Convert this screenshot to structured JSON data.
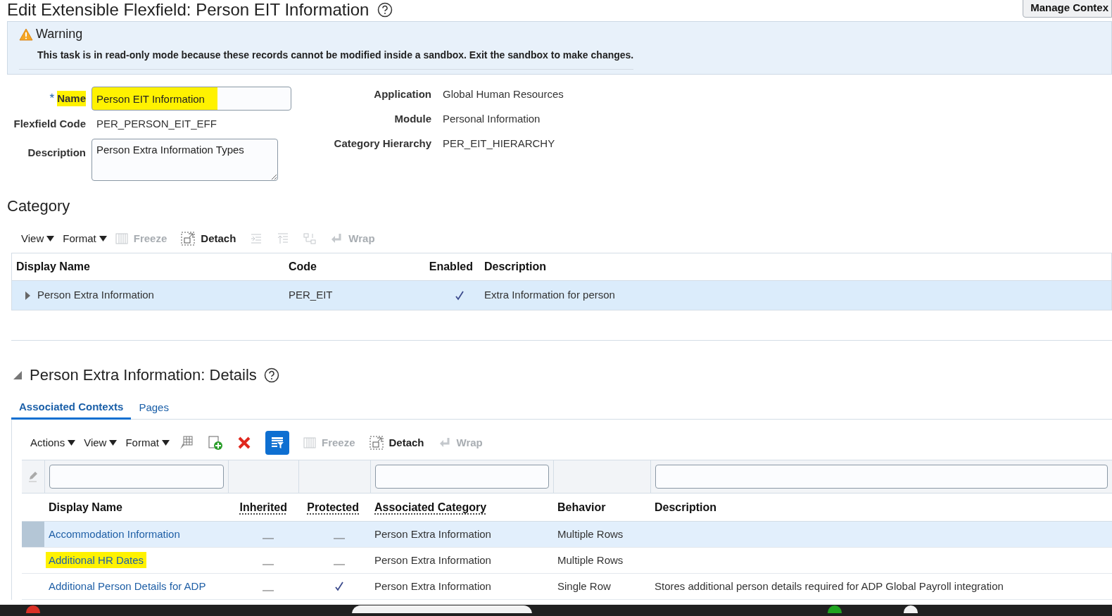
{
  "title": "Edit Extensible Flexfield: Person EIT Information",
  "manage_button": "Manage Contex",
  "warning": {
    "heading": "Warning",
    "message": "This task is in read-only mode because these records cannot be modified inside a sandbox. Exit the sandbox to make changes."
  },
  "form": {
    "name": {
      "label": "Name",
      "required_mark": "*",
      "value": "Person EIT Information",
      "highlighted": true
    },
    "flexfield_code": {
      "label": "Flexfield Code",
      "value": "PER_PERSON_EIT_EFF"
    },
    "description": {
      "label": "Description",
      "value": "Person Extra Information Types"
    },
    "right": [
      {
        "label": "Application",
        "value": "Global Human Resources"
      },
      {
        "label": "Module",
        "value": "Personal Information"
      },
      {
        "label": "Category Hierarchy",
        "value": "PER_EIT_HIERARCHY"
      }
    ]
  },
  "category": {
    "heading": "Category",
    "toolbar": [
      {
        "kind": "menu",
        "label": "View"
      },
      {
        "kind": "menu",
        "label": "Format"
      },
      {
        "kind": "freeze",
        "label": "Freeze",
        "disabled": true
      },
      {
        "kind": "detach",
        "label": "Detach",
        "disabled": false
      },
      {
        "kind": "indent",
        "disabled": true
      },
      {
        "kind": "outdent",
        "disabled": true
      },
      {
        "kind": "hierarchy",
        "disabled": true
      },
      {
        "kind": "wrap",
        "label": "Wrap",
        "disabled": true
      }
    ],
    "columns": [
      "Display Name",
      "Code",
      "Enabled",
      "Description"
    ],
    "rows": [
      {
        "display_name": "Person Extra Information",
        "code": "PER_EIT",
        "enabled": true,
        "description": "Extra Information for person",
        "selected": true,
        "expanded": false
      }
    ]
  },
  "details": {
    "heading": "Person Extra Information: Details",
    "tabs": [
      {
        "label": "Associated Contexts",
        "selected": true
      },
      {
        "label": "Pages",
        "selected": false
      }
    ],
    "toolbar": [
      {
        "kind": "menu",
        "label": "Actions"
      },
      {
        "kind": "menu",
        "label": "View"
      },
      {
        "kind": "menu",
        "label": "Format"
      },
      {
        "kind": "edit"
      },
      {
        "kind": "add"
      },
      {
        "kind": "delete"
      },
      {
        "kind": "filter",
        "disabled": false
      },
      {
        "kind": "freeze",
        "label": "Freeze",
        "disabled": true
      },
      {
        "kind": "detach",
        "label": "Detach",
        "disabled": false
      },
      {
        "kind": "wrap",
        "label": "Wrap",
        "disabled": true
      }
    ],
    "columns": [
      "Display Name",
      "Inherited",
      "Protected",
      "Associated Category",
      "Behavior",
      "Description"
    ],
    "rows": [
      {
        "display_name": "Accommodation Information",
        "inherited": false,
        "protected": false,
        "associated_category": "Person Extra Information",
        "behavior": "Multiple Rows",
        "selected": true,
        "highlighted": false
      },
      {
        "display_name": "Additional HR Dates",
        "inherited": false,
        "protected": false,
        "associated_category": "Person Extra Information",
        "behavior": "Multiple Rows",
        "selected": false,
        "highlighted": true
      },
      {
        "display_name": "Additional Person Details for ADP",
        "inherited": false,
        "protected": true,
        "associated_category": "Person Extra Information",
        "behavior": "Single Row",
        "description": "Stores additional person details required for ADP Global Payroll integration",
        "selected": false,
        "highlighted": false
      }
    ]
  }
}
